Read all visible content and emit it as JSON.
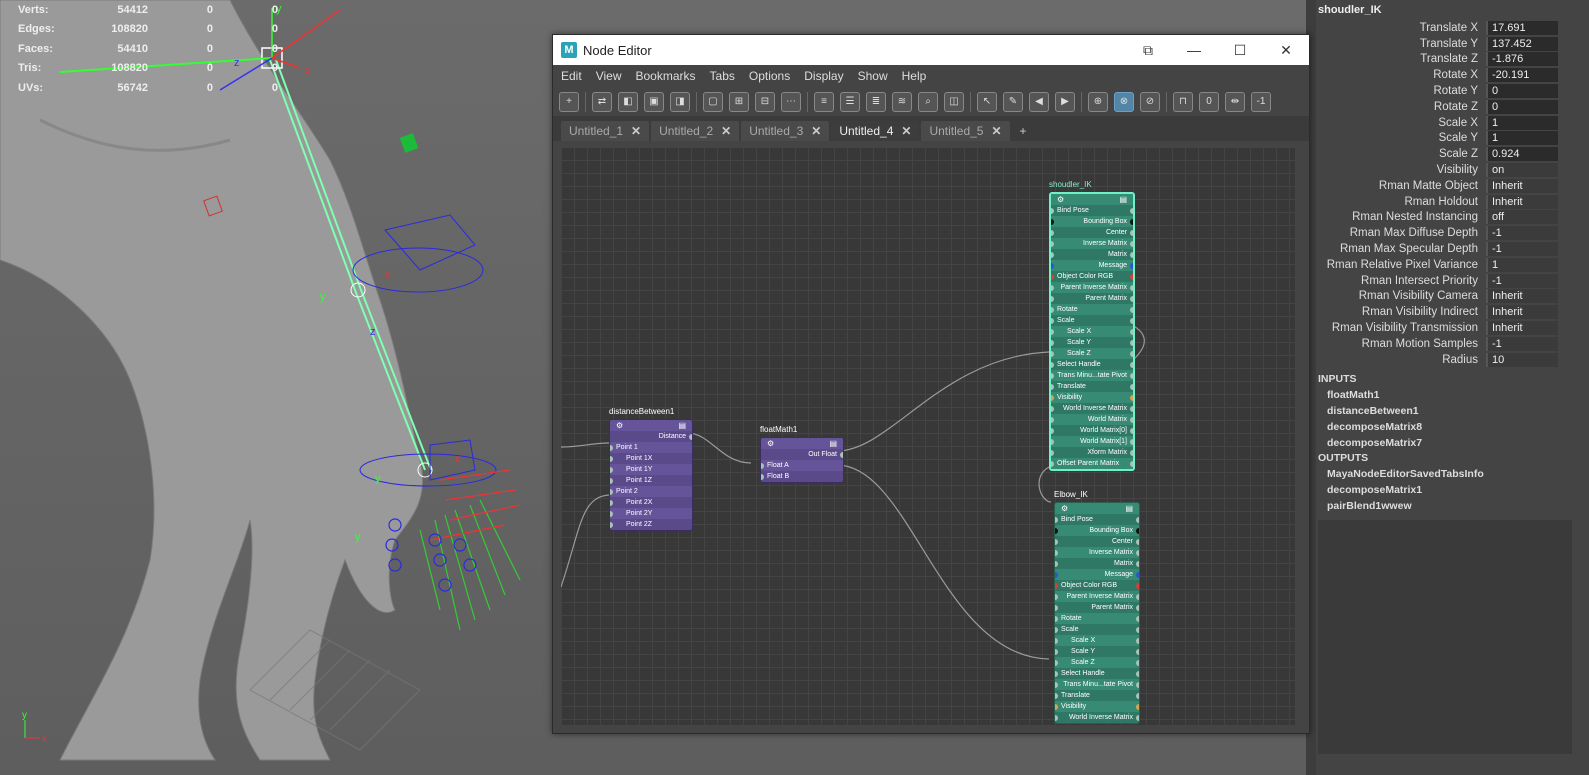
{
  "viewport": {
    "stats": [
      {
        "label": "Verts:",
        "v1": "54412",
        "v2": "0",
        "v3": "0"
      },
      {
        "label": "Edges:",
        "v1": "108820",
        "v2": "0",
        "v3": "0"
      },
      {
        "label": "Faces:",
        "v1": "54410",
        "v2": "0",
        "v3": "0"
      },
      {
        "label": "Tris:",
        "v1": "108820",
        "v2": "0",
        "v3": "0"
      },
      {
        "label": "UVs:",
        "v1": "56742",
        "v2": "0",
        "v3": "0"
      }
    ],
    "axis_labels": {
      "x": "x",
      "y": "y",
      "z": "z"
    },
    "colors": {
      "joint": "#7fffb0",
      "ctrl_blue": "#2a2ae0",
      "ctrl_red": "#e02020",
      "ctrl_green": "#20e020"
    }
  },
  "node_editor": {
    "title": "Node Editor",
    "menu": [
      "Edit",
      "View",
      "Bookmarks",
      "Tabs",
      "Options",
      "Display",
      "Show",
      "Help"
    ],
    "tabs": [
      {
        "label": "Untitled_1",
        "active": false
      },
      {
        "label": "Untitled_2",
        "active": false
      },
      {
        "label": "Untitled_3",
        "active": false
      },
      {
        "label": "Untitled_4",
        "active": true
      },
      {
        "label": "Untitled_5",
        "active": false
      }
    ],
    "add_tab": "+",
    "toolbar_text": {
      "zero": "0",
      "minus": "-1"
    },
    "nodes": {
      "distance": {
        "name": "distanceBetween1",
        "rows": [
          "Distance",
          "Point 1",
          "Point 1X",
          "Point 1Y",
          "Point 1Z",
          "Point 2",
          "Point 2X",
          "Point 2Y",
          "Point 2Z"
        ]
      },
      "float": {
        "name": "floatMath1",
        "rows": [
          "Out Float",
          "Float A",
          "Float B"
        ]
      },
      "shoulder": {
        "name": "shoudler_IK",
        "rows": [
          "Bind Pose",
          "Bounding Box",
          "Center",
          "Inverse Matrix",
          "Matrix",
          "Message",
          "Object Color RGB",
          "Parent Inverse Matrix",
          "Parent Matrix",
          "Rotate",
          "Scale",
          "Scale X",
          "Scale Y",
          "Scale Z",
          "Select Handle",
          "Trans Minu...tate Pivot",
          "Translate",
          "Visibility",
          "World Inverse Matrix",
          "World Matrix",
          "World Matrix[0]",
          "World Matrix[1]",
          "Xform Matrix",
          "Offset Parent Matrix"
        ]
      },
      "elbow": {
        "name": "Elbow_IK",
        "rows": [
          "Bind Pose",
          "Bounding Box",
          "Center",
          "Inverse Matrix",
          "Matrix",
          "Message",
          "Object Color RGB",
          "Parent Inverse Matrix",
          "Parent Matrix",
          "Rotate",
          "Scale",
          "Scale X",
          "Scale Y",
          "Scale Z",
          "Select Handle",
          "Trans Minu...tate Pivot",
          "Translate",
          "Visibility",
          "World Inverse Matrix"
        ]
      }
    }
  },
  "attribute_editor": {
    "title": "shoudler_IK",
    "attrs": [
      {
        "label": "Translate X",
        "value": "17.691"
      },
      {
        "label": "Translate Y",
        "value": "137.452"
      },
      {
        "label": "Translate Z",
        "value": "-1.876"
      },
      {
        "label": "Rotate X",
        "value": "-20.191"
      },
      {
        "label": "Rotate Y",
        "value": "0"
      },
      {
        "label": "Rotate Z",
        "value": "0"
      },
      {
        "label": "Scale X",
        "value": "1"
      },
      {
        "label": "Scale Y",
        "value": "1"
      },
      {
        "label": "Scale Z",
        "value": "0.924"
      },
      {
        "label": "Visibility",
        "value": "on"
      },
      {
        "label": "Rman Matte Object",
        "value": "Inherit"
      },
      {
        "label": "Rman Holdout",
        "value": "Inherit"
      },
      {
        "label": "Rman Nested Instancing",
        "value": "off"
      },
      {
        "label": "Rman Max Diffuse Depth",
        "value": "-1"
      },
      {
        "label": "Rman Max Specular Depth",
        "value": "-1"
      },
      {
        "label": "Rman Relative Pixel Variance",
        "value": "1"
      },
      {
        "label": "Rman Intersect Priority",
        "value": "-1"
      },
      {
        "label": "Rman Visibility Camera",
        "value": "Inherit"
      },
      {
        "label": "Rman Visibility Indirect",
        "value": "Inherit"
      },
      {
        "label": "Rman Visibility Transmission",
        "value": "Inherit"
      },
      {
        "label": "Rman Motion Samples",
        "value": "-1"
      },
      {
        "label": "Radius",
        "value": "10"
      }
    ],
    "inputs_label": "INPUTS",
    "inputs": [
      "floatMath1",
      "distanceBetween1",
      "decomposeMatrix8",
      "decomposeMatrix7"
    ],
    "outputs_label": "OUTPUTS",
    "outputs": [
      "MayaNodeEditorSavedTabsInfo",
      "decomposeMatrix1",
      "pairBlend1wwew"
    ]
  }
}
